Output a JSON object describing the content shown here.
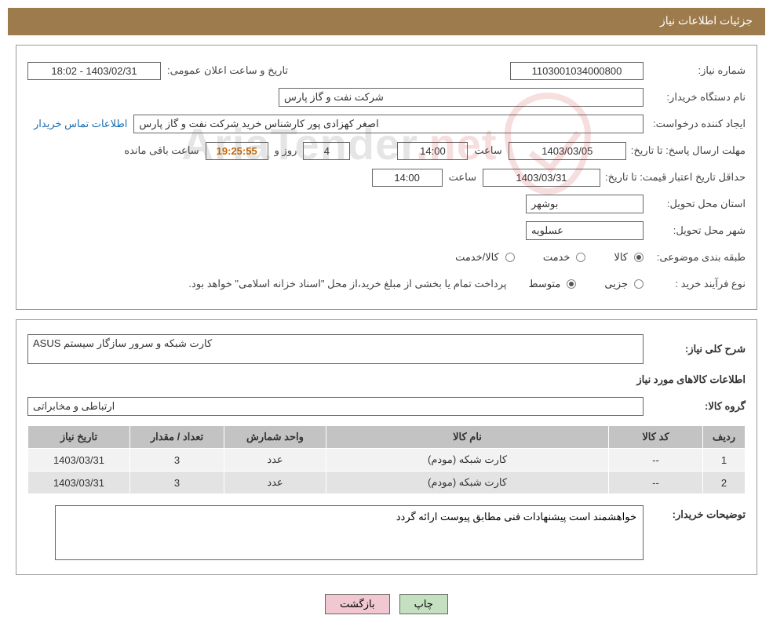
{
  "header": {
    "title": "جزئیات اطلاعات نیاز"
  },
  "section1": {
    "reqNoLabel": "شماره نیاز:",
    "reqNo": "1103001034000800",
    "pubDateLabel": "تاریخ و ساعت اعلان عمومی:",
    "pubDate": "1403/02/31 - 18:02",
    "buyerOrgLabel": "نام دستگاه خریدار:",
    "buyerOrg": "شرکت نفت و گاز پارس",
    "requesterLabel": "ایجاد کننده درخواست:",
    "requester": "اصغر کهزادی پور کارشناس خرید شرکت نفت و گاز پارس",
    "buyerContactLink": "اطلاعات تماس خریدار",
    "replyDeadlineLabel": "مهلت ارسال پاسخ: تا تاریخ:",
    "replyDeadlineDate": "1403/03/05",
    "timeLabel": "ساعت",
    "replyDeadlineTime": "14:00",
    "daysLabel": "روز و",
    "days": "4",
    "timer": "19:25:55",
    "remainLabel": "ساعت باقی مانده",
    "priceValidityLabel": "حداقل تاریخ اعتبار قیمت: تا تاریخ:",
    "priceValidityDate": "1403/03/31",
    "priceValidityTime": "14:00",
    "provinceLabel": "استان محل تحویل:",
    "province": "بوشهر",
    "cityLabel": "شهر محل تحویل:",
    "city": "عسلویه",
    "classificationLabel": "طبقه بندی موضوعی:",
    "classOptions": {
      "goods": "کالا",
      "service": "خدمت",
      "goodsService": "کالا/خدمت"
    },
    "purchaseTypeLabel": "نوع فرآیند خرید :",
    "purchaseOptions": {
      "minor": "جزیی",
      "medium": "متوسط"
    },
    "purchaseNote": "پرداخت تمام یا بخشی از مبلغ خرید،از محل \"اسناد خزانه اسلامی\" خواهد بود."
  },
  "section2": {
    "summaryLabel": "شرح کلی نیاز:",
    "summary": "کارت شبکه و سرور سازگار سیستم ASUS",
    "itemsHeader": "اطلاعات کالاهای مورد نیاز",
    "groupLabel": "گروه کالا:",
    "group": "ارتباطی و مخابراتی",
    "table": {
      "headers": {
        "row": "ردیف",
        "code": "کد کالا",
        "name": "نام کالا",
        "unit": "واحد شمارش",
        "qty": "تعداد / مقدار",
        "date": "تاریخ نیاز"
      },
      "rows": [
        {
          "row": "1",
          "code": "--",
          "name": "کارت شبکه (مودم)",
          "unit": "عدد",
          "qty": "3",
          "date": "1403/03/31"
        },
        {
          "row": "2",
          "code": "--",
          "name": "کارت شبکه (مودم)",
          "unit": "عدد",
          "qty": "3",
          "date": "1403/03/31"
        }
      ]
    },
    "buyerNotesLabel": "توضیحات خریدار:",
    "buyerNotes": "خواهشمند است پیشنهادات فنی مطابق پیوست ارائه گردد"
  },
  "buttons": {
    "print": "چاپ",
    "back": "بازگشت"
  },
  "watermark": {
    "textA": "AriaTender",
    "textB": ".net"
  }
}
